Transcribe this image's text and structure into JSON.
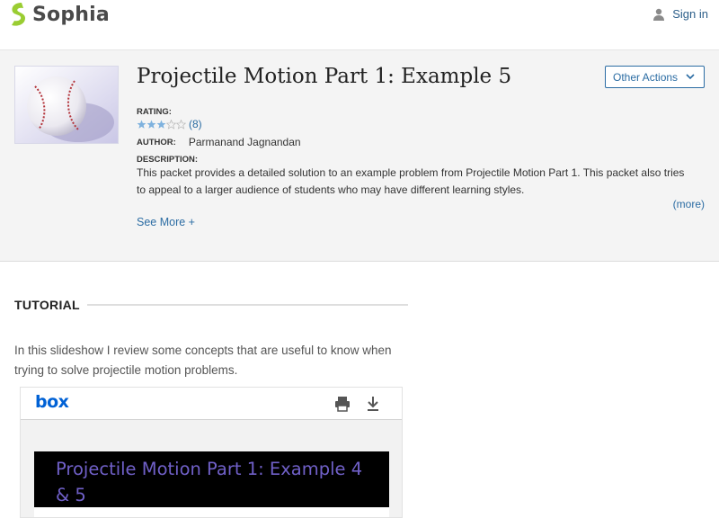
{
  "nav": {
    "brand": "Sophia",
    "brand_color": "#9acd32",
    "signin_label": "Sign in",
    "signin_icon": "user-icon"
  },
  "packet": {
    "title": "Projectile Motion Part 1: Example 5",
    "other_actions_label": "Other Actions",
    "rating_label": "RATING:",
    "rating_value": 3,
    "rating_max": 5,
    "rating_count": "(8)",
    "author_label": "AUTHOR:",
    "author_name": "Parmanand Jagnandan",
    "description_label": "DESCRIPTION:",
    "description": "This packet provides a detailed solution to an example problem from Projectile Motion Part 1. This packet also tries to appeal to a larger audience of students who may have different learning styles.",
    "more_label": "(more)",
    "see_more_label": "See More +",
    "thumbnail": "baseball-image"
  },
  "tutorial": {
    "heading": "TUTORIAL",
    "intro": "In this slideshow I review some concepts that are useful to know when trying to solve projectile motion problems."
  },
  "embed": {
    "provider": "box",
    "print_icon": "print-icon",
    "download_icon": "download-icon",
    "slide_title": "Projectile Motion Part 1: Example 4 & 5"
  },
  "colors": {
    "link": "#2b6ca3",
    "box_blue": "#0061d5",
    "star_fill": "#7fb2de",
    "slide_text": "#7060c8"
  }
}
